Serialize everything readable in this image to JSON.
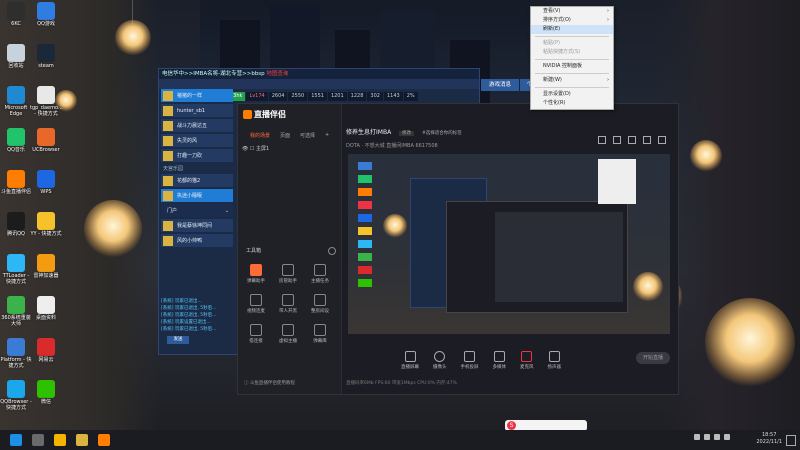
{
  "desktop_icons": [
    {
      "label": "6KC",
      "color": "#2e2e2e"
    },
    {
      "label": "QQ游戏",
      "color": "#2f7de1"
    },
    {
      "label": "回收站",
      "color": "#c7d2dd"
    },
    {
      "label": "steam",
      "color": "#1b2838"
    },
    {
      "label": "Microsoft Edge",
      "color": "#1f8ad2"
    },
    {
      "label": "tgp_daemo... - 快捷方式",
      "color": "#e8e8e8"
    },
    {
      "label": "QQ音乐",
      "color": "#21c36b"
    },
    {
      "label": "UCBrowser",
      "color": "#e8682a"
    },
    {
      "label": "斗鱼直播伴侣",
      "color": "#ff7d00"
    },
    {
      "label": "WPS",
      "color": "#1e67e2"
    },
    {
      "label": "腾讯QQ",
      "color": "#1c1c1c"
    },
    {
      "label": "YY - 快捷方式",
      "color": "#f6c22b"
    },
    {
      "label": "TTLoader - 快捷方式",
      "color": "#2db7f5"
    },
    {
      "label": "雷神加速器",
      "color": "#f39c12"
    },
    {
      "label": "360系统重装大师",
      "color": "#3bb34a"
    },
    {
      "label": "桌面资料",
      "color": "#eeeeee"
    },
    {
      "label": "Platform - 快捷方式",
      "color": "#3a7bd5"
    },
    {
      "label": "网易云",
      "color": "#d92b2b"
    },
    {
      "label": "QQBrowser - 快捷方式",
      "color": "#1aa7ec"
    },
    {
      "label": "微信",
      "color": "#2dc100"
    }
  ],
  "game": {
    "title": "电信华中>>IMBA名将-湖北专营>>bbsp",
    "title_flag": "地图查询",
    "buttons": [
      "游戏消息",
      "个人"
    ],
    "stats": [
      "33hk",
      "Lv174",
      "2604",
      "2550",
      "1551",
      "1201",
      "1228",
      "302",
      "1143",
      "2%"
    ],
    "players": [
      "猪猪的一样",
      "hunter_sb1",
      "战斗力晨达五",
      "失灵的风",
      "打趣一刀砍"
    ],
    "section_label": "天宫乐园",
    "players2": [
      "花都的猫2",
      "执迷小睡眠"
    ],
    "dropdown": "门户",
    "players3": [
      "我是蔡徐坤同间",
      "风的小帅鸭"
    ],
    "chat": [
      "[系统] 玩家已退出...",
      "[系统] 玩家已退出, 5秒后...",
      "[系统] 玩家已退出, 5秒后...",
      "[系统] 玩家设置已退出...",
      "[系统] 玩家已退出, 5秒后...",
      "[系统] 玩家已退出, 5秒后..."
    ],
    "send": "发送"
  },
  "stream_app": {
    "logo": "直播伴侣",
    "tabs": [
      "我的场景",
      "页面",
      "可选择"
    ],
    "scene": "主屏1",
    "tools_title": "工具箱",
    "tools": [
      "弹幕助手",
      "房管助手",
      "主播任务",
      "视频连麦",
      "带人开黑",
      "整房间设",
      "搭连接",
      "虚拟主播",
      "弹幕库"
    ],
    "bottom_notice": "斗鱼直播伴侣使用教程",
    "header": "修养生息打IMBA",
    "header_tag": "修改",
    "header_desc": "#选择适合你的标签",
    "sub": "DOTA · 不想大城   直播间IMBA   6617508",
    "bottom_buttons": [
      "直播屏幕",
      "摄像头",
      "手机投屏",
      "多媒体",
      "麦克风",
      "扬声器"
    ],
    "start_live": "开始直播",
    "status": "直播码率6Mb   FPS:60   带宽1Mbps   CPU:0%   内存:47%"
  },
  "context_menu": {
    "items": [
      {
        "label": "查看(V)",
        "arrow": true,
        "disabled": false
      },
      {
        "label": "排序方式(O)",
        "arrow": true,
        "disabled": false
      },
      {
        "label": "刷新(E)",
        "arrow": false,
        "disabled": false,
        "highlight": true
      },
      {
        "sep": true
      },
      {
        "label": "粘贴(P)",
        "arrow": false,
        "disabled": true
      },
      {
        "label": "粘贴快捷方式(S)",
        "arrow": false,
        "disabled": true
      },
      {
        "sep": true
      },
      {
        "label": "NVIDIA 控制面板",
        "arrow": false,
        "disabled": false
      },
      {
        "sep": true
      },
      {
        "label": "新建(W)",
        "arrow": true,
        "disabled": false
      },
      {
        "sep": true
      },
      {
        "label": "显示设置(D)",
        "arrow": false,
        "disabled": false
      },
      {
        "label": "个性化(R)",
        "arrow": false,
        "disabled": false
      }
    ]
  },
  "taskbar": {
    "time": "18:57",
    "date": "2022/11/1"
  },
  "colors": {
    "accent": "#ff7d00",
    "game_bg": "#1b2a45"
  }
}
